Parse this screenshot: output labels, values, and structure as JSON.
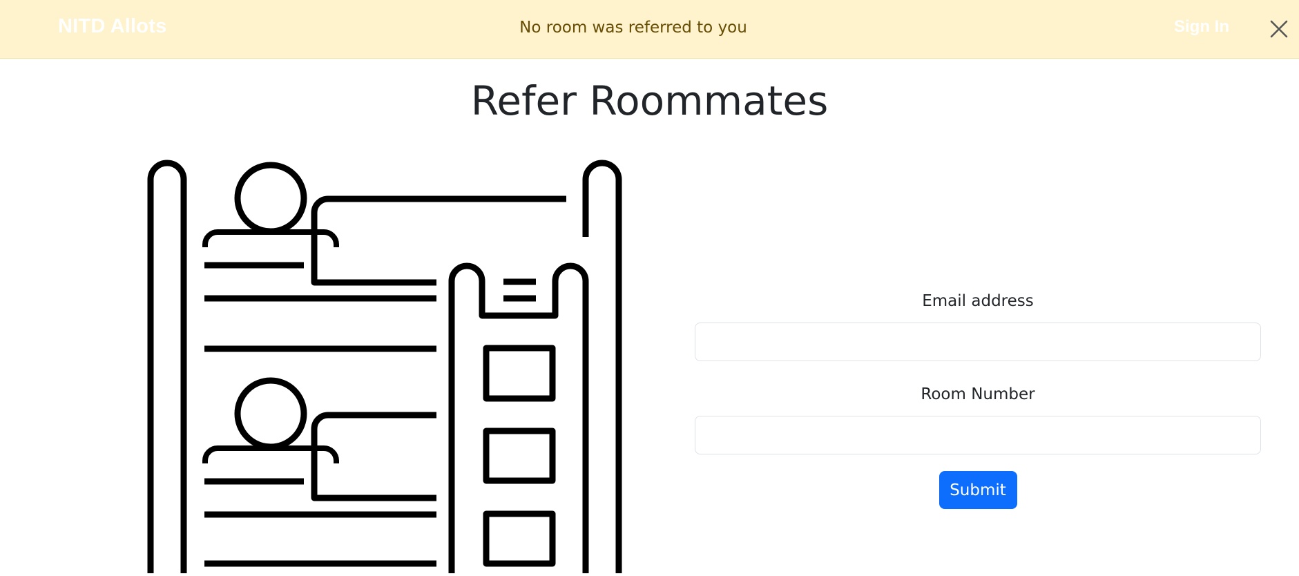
{
  "navbar": {
    "brand": "NITD Allots",
    "sign_in": "Sign In"
  },
  "alert": {
    "message": "No room was referred to you",
    "close_icon": "close-icon",
    "background": "#fff3cd",
    "text_color": "#664d03"
  },
  "page": {
    "title": "Refer Roommates"
  },
  "illustration": {
    "icon": "bunk-bed-roommates-icon"
  },
  "form": {
    "email_label": "Email address",
    "email_value": "",
    "room_label": "Room Number",
    "room_value": "",
    "submit_label": "Submit",
    "submit_color": "#0d6efd"
  }
}
